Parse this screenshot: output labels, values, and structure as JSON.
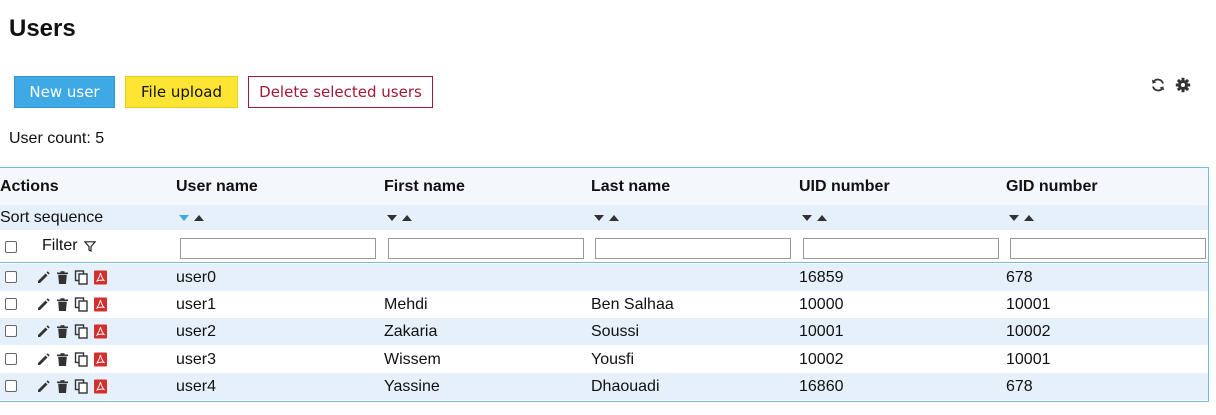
{
  "page": {
    "title": "Users"
  },
  "toolbar": {
    "new_user_label": "New user",
    "file_upload_label": "File upload",
    "delete_selected_label": "Delete selected users",
    "refresh_icon": "refresh-icon",
    "settings_icon": "gear-icon"
  },
  "summary": {
    "user_count_text": "User count: 5"
  },
  "colors": {
    "accent": "#3ea9e4",
    "upload": "#fee533",
    "danger": "#a31835",
    "row_stripe": "#e5f0fb",
    "pdf": "#d32f2f"
  },
  "table": {
    "columns": {
      "actions": "Actions",
      "username": "User name",
      "firstname": "First name",
      "lastname": "Last name",
      "uid": "UID number",
      "gid": "GID number"
    },
    "sort_label": "Sort sequence",
    "sort_active": {
      "column": "username",
      "direction": "descending"
    },
    "filter_label": "Filter",
    "filter_values": {
      "username": "",
      "firstname": "",
      "lastname": "",
      "uid": "",
      "gid": ""
    },
    "row_action_icons": [
      "edit-icon",
      "trash-icon",
      "copy-icon",
      "pdf-icon"
    ],
    "rows": [
      {
        "username": "user0",
        "firstname": "",
        "lastname": "",
        "uid": "16859",
        "gid": "678"
      },
      {
        "username": "user1",
        "firstname": "Mehdi",
        "lastname": "Ben Salhaa",
        "uid": "10000",
        "gid": "10001"
      },
      {
        "username": "user2",
        "firstname": "Zakaria",
        "lastname": "Soussi",
        "uid": "10001",
        "gid": "10002"
      },
      {
        "username": "user3",
        "firstname": "Wissem",
        "lastname": "Yousfi",
        "uid": "10002",
        "gid": "10001"
      },
      {
        "username": "user4",
        "firstname": "Yassine",
        "lastname": "Dhaouadi",
        "uid": "16860",
        "gid": "678"
      }
    ]
  }
}
